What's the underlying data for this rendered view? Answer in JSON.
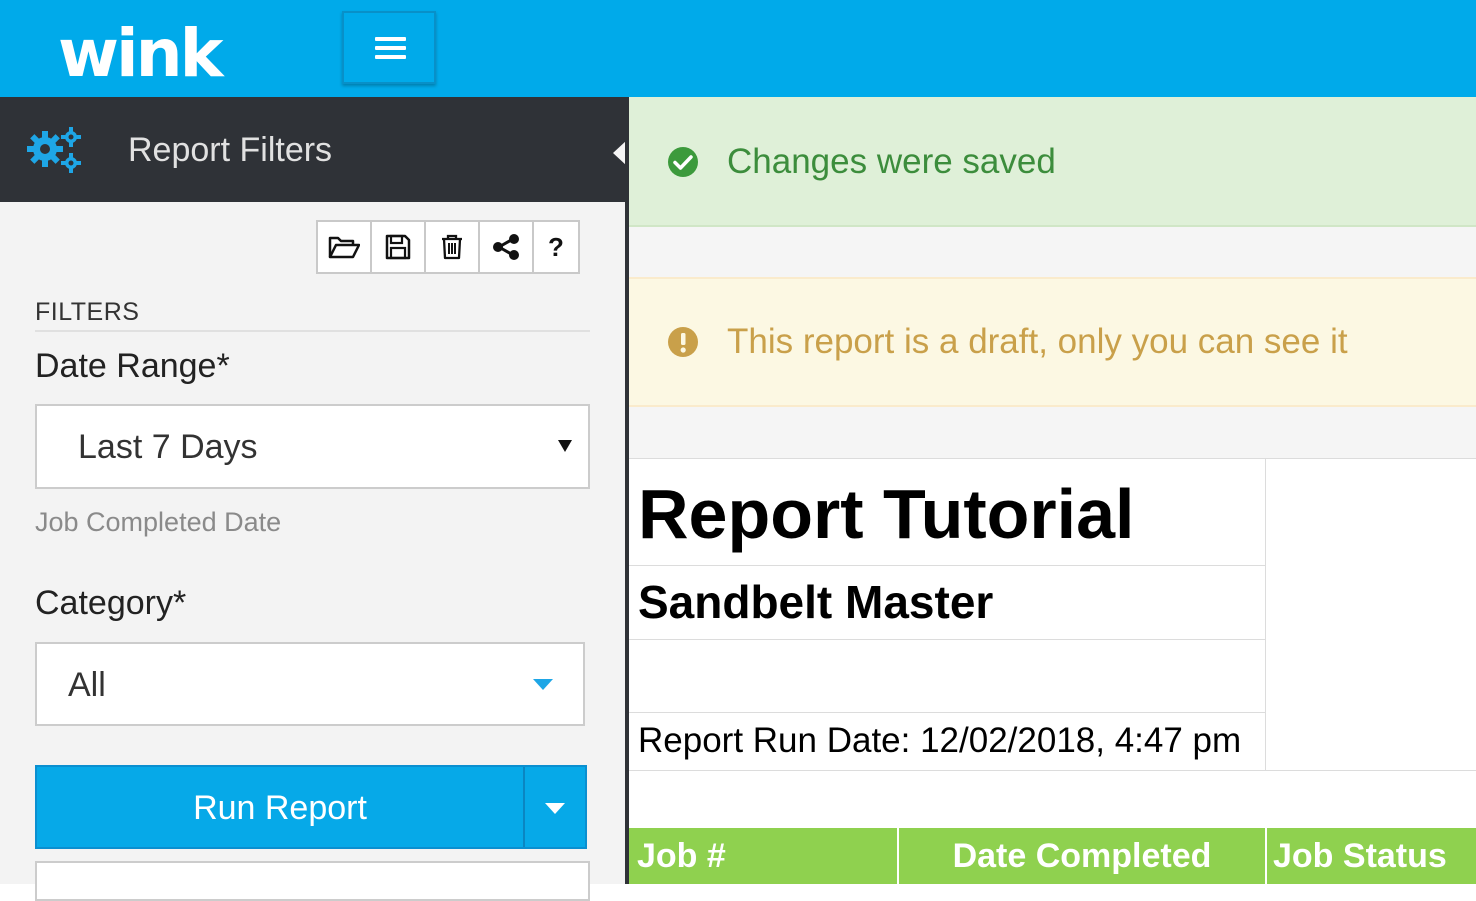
{
  "header": {
    "logo_text": "wink",
    "menu_icon": "hamburger-icon"
  },
  "sidebar": {
    "title": "Report Filters",
    "title_icon": "gears-icon",
    "toolbar": [
      {
        "name": "open-folder-icon",
        "label": ""
      },
      {
        "name": "save-icon",
        "label": ""
      },
      {
        "name": "trash-icon",
        "label": ""
      },
      {
        "name": "share-icon",
        "label": ""
      },
      {
        "name": "help-icon",
        "label": "?"
      }
    ],
    "section_label": "FILTERS",
    "date_range": {
      "label": "Date Range*",
      "value": "Last 7 Days",
      "hint": "Job Completed Date"
    },
    "category": {
      "label": "Category*",
      "value": "All"
    },
    "run_button": "Run Report"
  },
  "alerts": {
    "success": "Changes were saved",
    "warning": "This report is a draft, only you can see it"
  },
  "report": {
    "title": "Report Tutorial",
    "subtitle": "Sandbelt Master",
    "run_date": "Report Run Date: 12/02/2018, 4:47 pm",
    "columns": [
      "Job #",
      "Date Completed",
      "Job Status"
    ]
  },
  "colors": {
    "brand": "#00aaea",
    "sidebar_dark": "#2f3237",
    "success_bg": "#dff0d8",
    "success_text": "#3c8d3c",
    "warning_bg": "#fcf8e3",
    "warning_text": "#c9a04a",
    "table_header": "#8fd14f"
  }
}
